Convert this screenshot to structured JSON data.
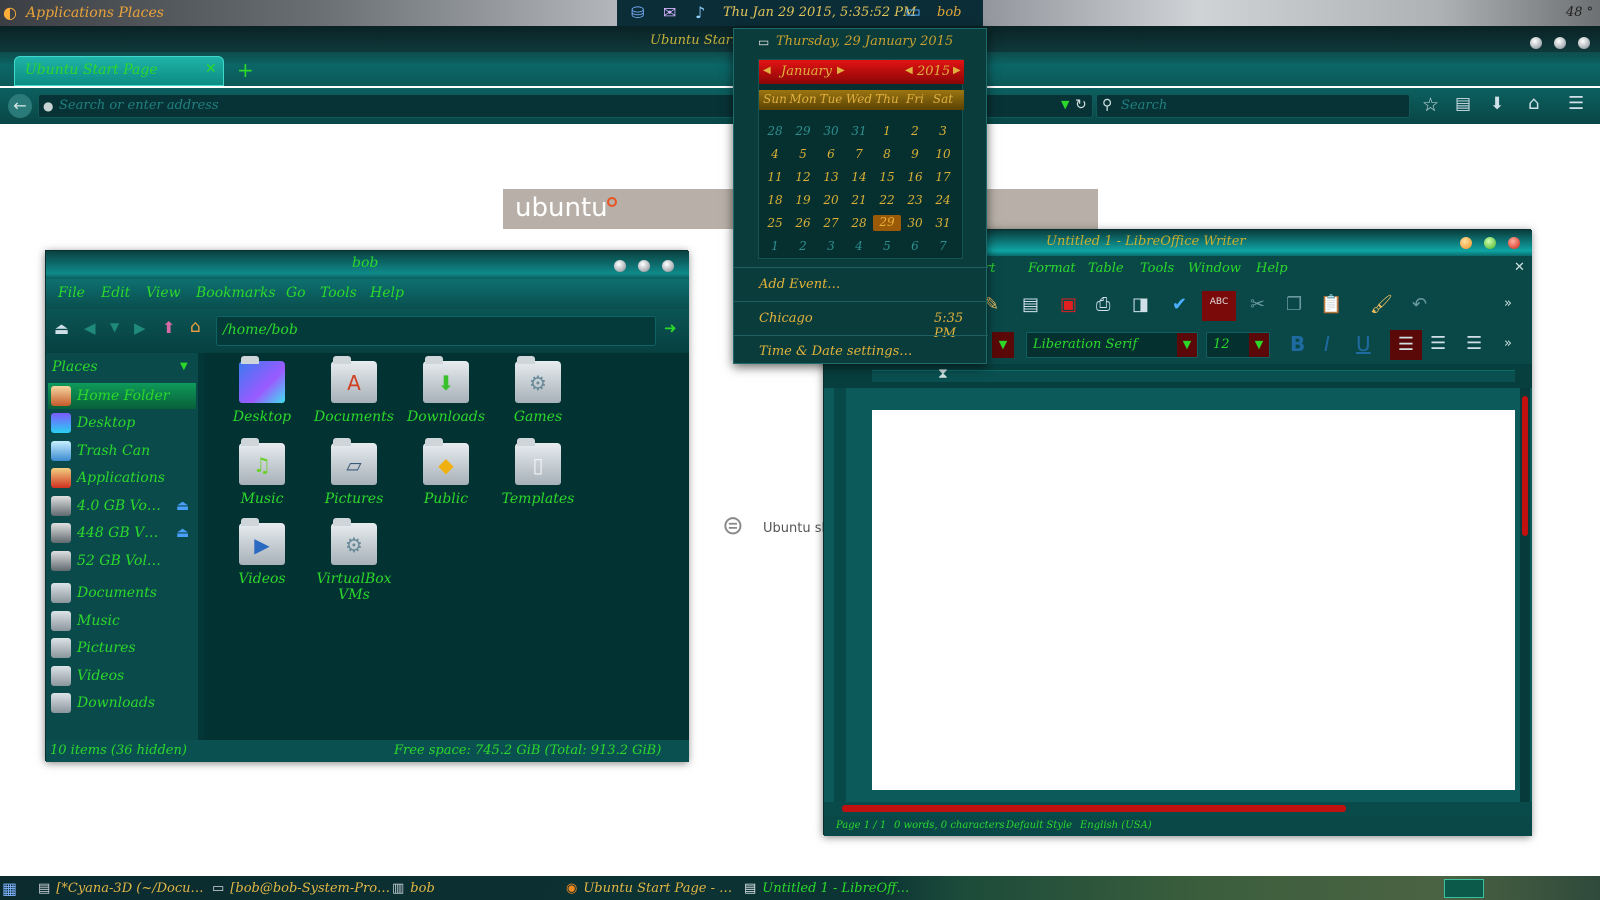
{
  "topbar": {
    "app_menu": "Applications Places",
    "clock": "Thu Jan 29 2015, 5:35:52 PM",
    "user": "bob",
    "temp": "48 °"
  },
  "firefox": {
    "window_title": "Ubuntu Start Page",
    "tab_label": "Ubuntu Start Page",
    "address_placeholder": "Search or enter address",
    "search_placeholder": "Search",
    "banner_logo": "ubuntu",
    "bg_link": "Ubuntu sh"
  },
  "calendar": {
    "date_line": "Thursday, 29 January 2015",
    "month": "January",
    "year": "2015",
    "weekdays": [
      "Sun",
      "Mon",
      "Tue",
      "Wed",
      "Thu",
      "Fri",
      "Sat"
    ],
    "weeks": [
      [
        "28",
        "29",
        "30",
        "31",
        "1",
        "2",
        "3"
      ],
      [
        "4",
        "5",
        "6",
        "7",
        "8",
        "9",
        "10"
      ],
      [
        "11",
        "12",
        "13",
        "14",
        "15",
        "16",
        "17"
      ],
      [
        "18",
        "19",
        "20",
        "21",
        "22",
        "23",
        "24"
      ],
      [
        "25",
        "26",
        "27",
        "28",
        "29",
        "30",
        "31"
      ],
      [
        "1",
        "2",
        "3",
        "4",
        "5",
        "6",
        "7"
      ]
    ],
    "add_event": "Add Event…",
    "location": "Chicago",
    "location_time": "5:35 PM",
    "settings": "Time & Date settings…"
  },
  "nautilus": {
    "title": "bob",
    "menu": [
      "File",
      "Edit",
      "View",
      "Bookmarks",
      "Go",
      "Tools",
      "Help"
    ],
    "path": "/home/bob",
    "places_header": "Places",
    "places": [
      "Home Folder",
      "Desktop",
      "Trash Can",
      "Applications",
      "4.0 GB Vo…",
      "448 GB V…",
      "52 GB Vol…",
      "Documents",
      "Music",
      "Pictures",
      "Videos",
      "Downloads"
    ],
    "files": [
      "Desktop",
      "Documents",
      "Downloads",
      "Games",
      "Music",
      "Pictures",
      "Public",
      "Templates",
      "Videos",
      "VirtualBox VMs"
    ],
    "status_items": "10 items (36 hidden)",
    "status_space": "Free space: 745.2 GiB (Total: 913.2 GiB)"
  },
  "writer": {
    "title": "Untitled 1 - LibreOffice Writer",
    "menu": [
      "rt",
      "Format",
      "Table",
      "Tools",
      "Window",
      "Help"
    ],
    "font_name": "Liberation Serif",
    "font_size": "12",
    "status": [
      "Page 1 / 1",
      "0 words, 0 characters",
      "Default Style",
      "English (USA)"
    ]
  },
  "taskbar": {
    "items": [
      "[*Cyana-3D (~/Docu…",
      "[bob@bob-System-Pro…",
      "bob",
      "Ubuntu Start Page - …",
      "Untitled 1 - LibreOff…"
    ]
  }
}
